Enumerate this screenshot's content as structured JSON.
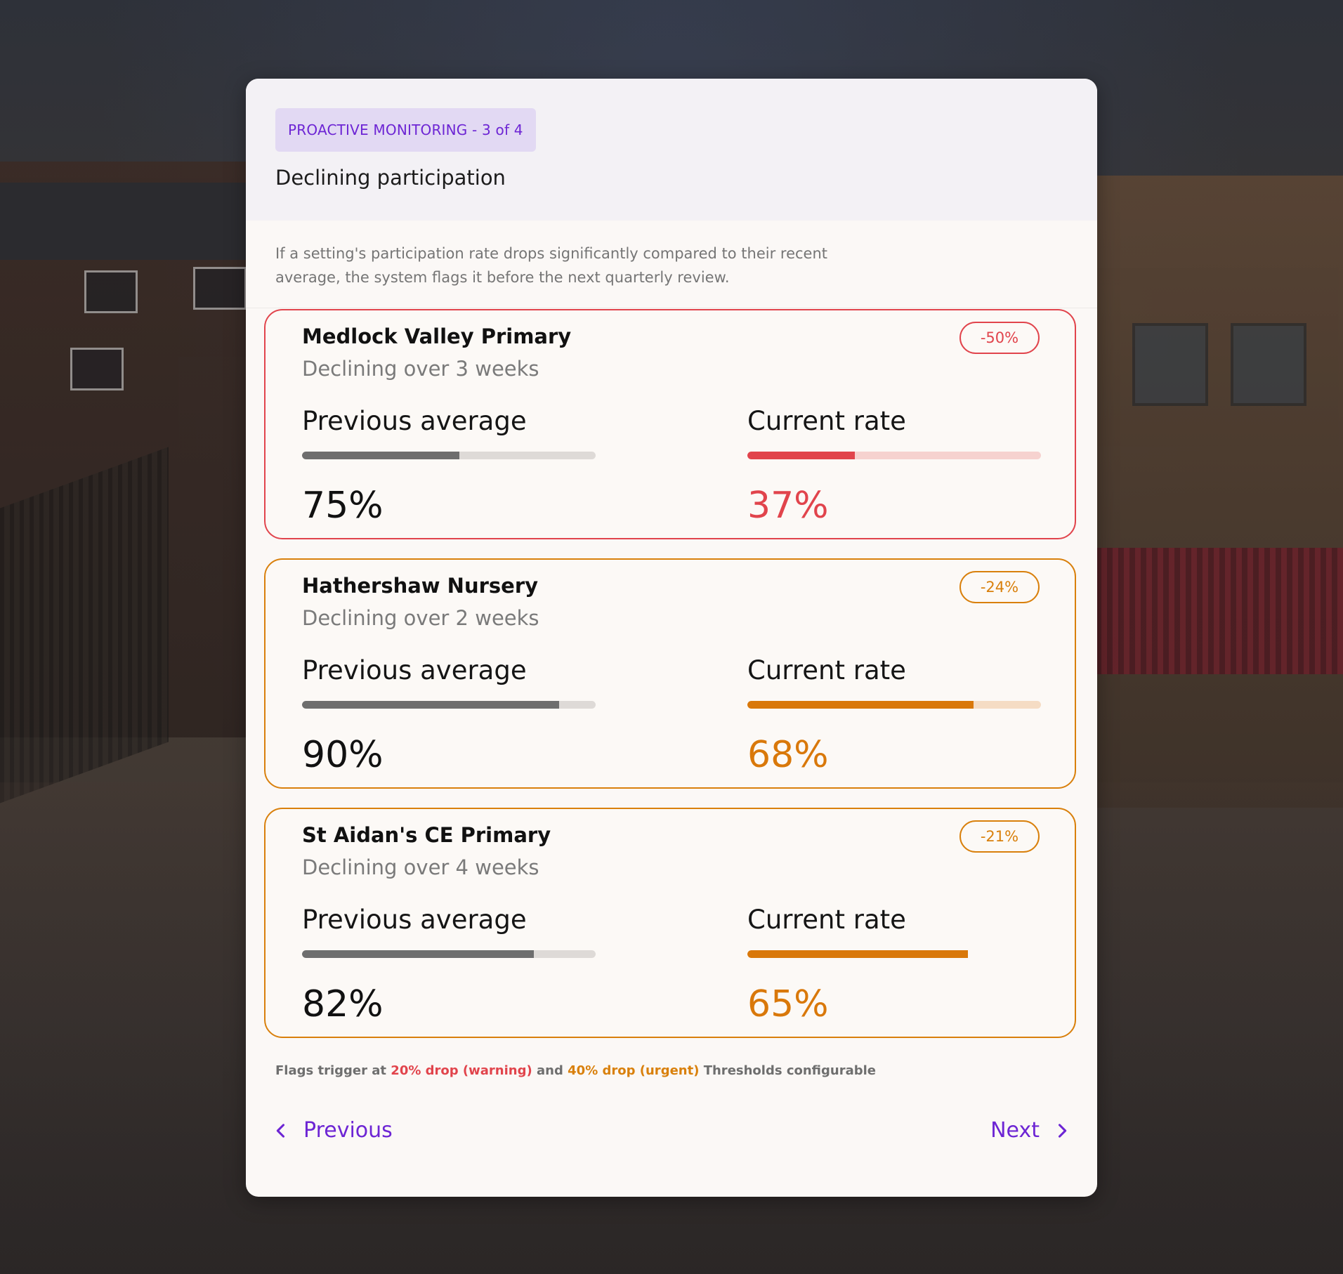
{
  "header": {
    "tag": "PROACTIVE MONITORING - 3 of 4",
    "title": "Declining participation"
  },
  "description": "If a setting's participation rate drops significantly compared to their recent average, the system flags it before the next quarterly review.",
  "alerts": [
    {
      "name": "Medlock Valley Primary",
      "subtitle": "Declining over 3 weeks",
      "badge": "-50%",
      "severity": "urgent",
      "previous_label": "Previous average",
      "previous_value": "75%",
      "previous_fraction": 0.535,
      "current_label": "Current rate",
      "current_value": "37%",
      "current_fraction": 0.365
    },
    {
      "name": "Hathershaw Nursery",
      "subtitle": "Declining over 2 weeks",
      "badge": "-24%",
      "severity": "warning",
      "previous_label": "Previous average",
      "previous_value": "90%",
      "previous_fraction": 0.875,
      "current_label": "Current rate",
      "current_value": "68%",
      "current_fraction": 0.77
    },
    {
      "name": "St Aidan's CE Primary",
      "subtitle": "Declining over 4 weeks",
      "badge": "-21%",
      "severity": "warning",
      "previous_label": "Previous average",
      "previous_value": "82%",
      "previous_fraction": 0.79,
      "current_label": "Current rate",
      "current_value": "65%",
      "current_fraction": 0.75
    }
  ],
  "footnote": {
    "prefix": "Flags trigger at",
    "warning_text": "20% drop (warning)",
    "joiner": "and",
    "urgent_text": "40% drop (urgent)",
    "suffix": "Thresholds configurable"
  },
  "navigation": {
    "previous_label": "Previous",
    "next_label": "Next"
  },
  "colors": {
    "accent": "#6d25d4",
    "urgent": "#e1444c",
    "warning": "#d9800c"
  }
}
